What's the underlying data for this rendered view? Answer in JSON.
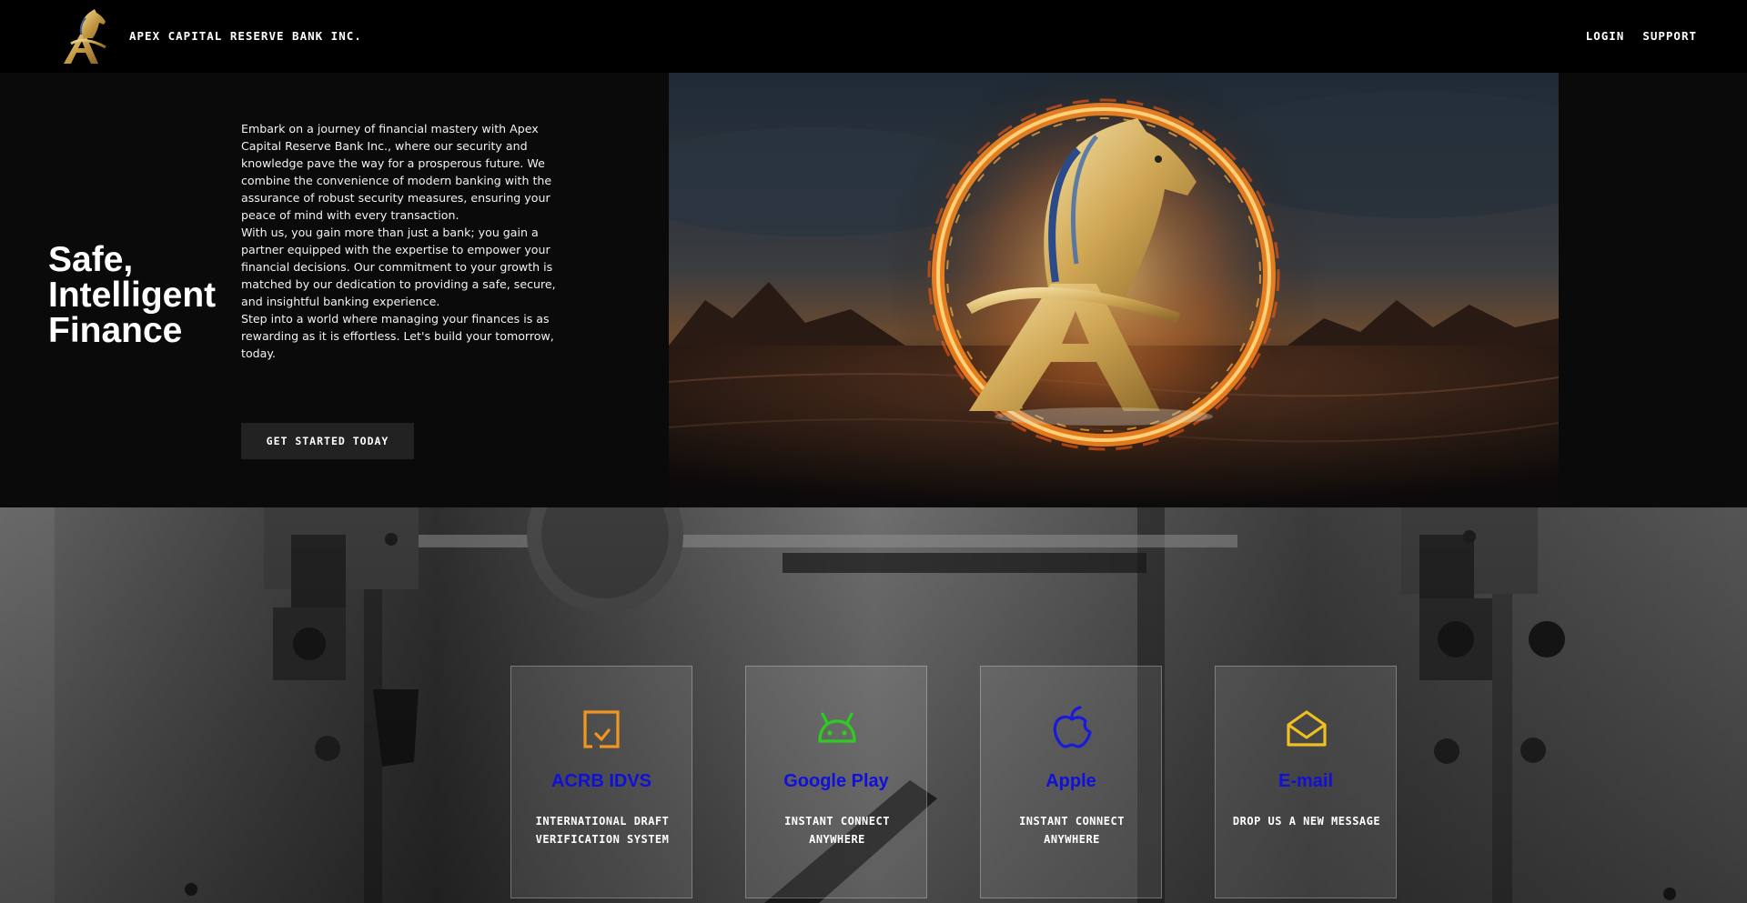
{
  "header": {
    "brand": "APEX CAPITAL RESERVE BANK INC.",
    "nav": [
      {
        "label": "LOGIN"
      },
      {
        "label": "SUPPORT"
      }
    ]
  },
  "hero": {
    "title_lines": [
      "Safe,",
      "Intelligent",
      "Finance"
    ],
    "paragraphs": [
      "Embark on a journey of financial mastery with Apex Capital Reserve Bank Inc., where our security and knowledge pave the way for a prosperous future. We combine the convenience of modern banking with the assurance of robust security measures, ensuring your peace of mind with every transaction.",
      "With us, you gain more than just a bank; you gain a partner equipped with the expertise to empower your financial decisions. Our commitment to your growth is matched by our dedication to providing a safe, secure, and insightful banking experience.",
      "Step into a world where managing your finances is as rewarding as it is effortless. Let's build your tomorrow, today."
    ],
    "cta_label": "GET STARTED TODAY"
  },
  "cards": [
    {
      "icon": "check-square-icon",
      "icon_color": "#f0961e",
      "title": "ACRB IDVS",
      "subtitle": "INTERNATIONAL DRAFT VERIFICATION SYSTEM"
    },
    {
      "icon": "android-icon",
      "icon_color": "#2ecc20",
      "title": "Google Play",
      "subtitle": "INSTANT CONNECT ANYWHERE"
    },
    {
      "icon": "apple-icon",
      "icon_color": "#1a1adb",
      "title": "Apple",
      "subtitle": "INSTANT CONNECT ANYWHERE"
    },
    {
      "icon": "envelope-open-icon",
      "icon_color": "#f0c020",
      "title": "E-mail",
      "subtitle": "DROP US A NEW MESSAGE"
    }
  ],
  "colors": {
    "accent_gold": "#d4b060",
    "card_title_blue": "#1010dd",
    "cta_bg": "#222222"
  }
}
